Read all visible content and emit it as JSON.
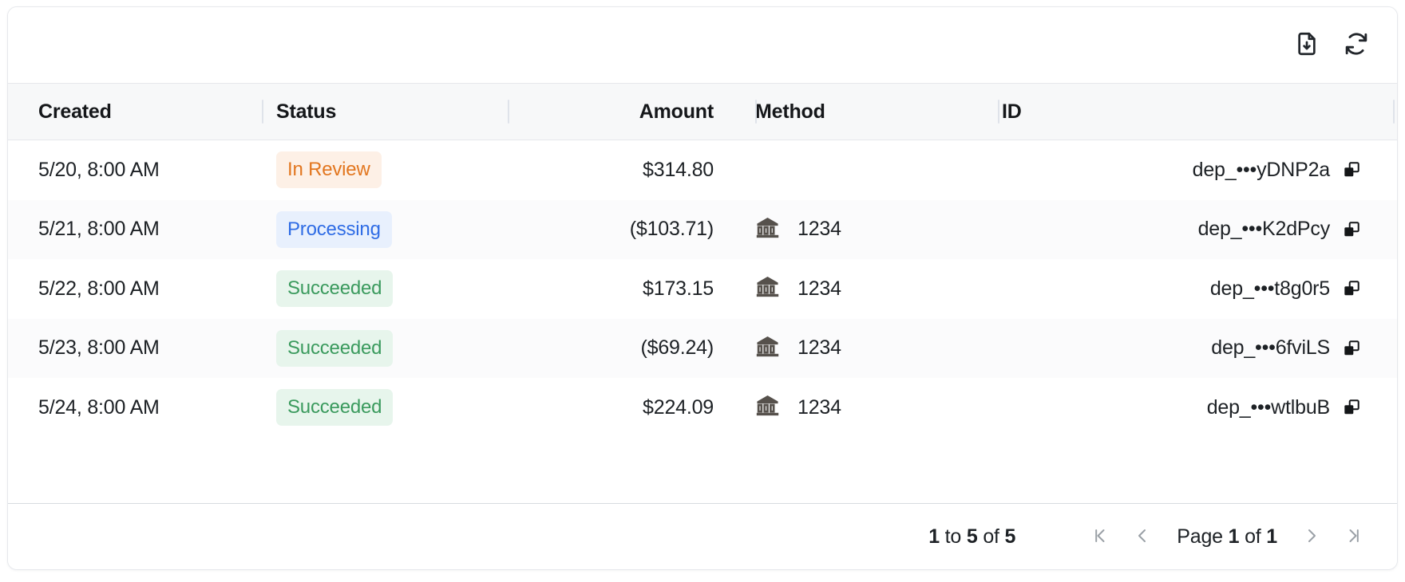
{
  "toolbar": {
    "export_label": "download-document",
    "refresh_label": "refresh"
  },
  "table": {
    "columns": [
      {
        "key": "created",
        "label": "Created",
        "align": "left"
      },
      {
        "key": "status",
        "label": "Status",
        "align": "left"
      },
      {
        "key": "amount",
        "label": "Amount",
        "align": "right"
      },
      {
        "key": "method",
        "label": "Method",
        "align": "left"
      },
      {
        "key": "id",
        "label": "ID",
        "align": "right"
      }
    ],
    "rows": [
      {
        "created": "5/20, 8:00 AM",
        "status": "In Review",
        "status_kind": "review",
        "amount": "$314.80",
        "method_icon": "",
        "method": "",
        "id": "dep_•••yDNP2a"
      },
      {
        "created": "5/21, 8:00 AM",
        "status": "Processing",
        "status_kind": "process",
        "amount": "($103.71)",
        "method_icon": "bank",
        "method": "1234",
        "id": "dep_•••K2dPcy"
      },
      {
        "created": "5/22, 8:00 AM",
        "status": "Succeeded",
        "status_kind": "succeeded",
        "amount": "$173.15",
        "method_icon": "bank",
        "method": "1234",
        "id": "dep_•••t8g0r5"
      },
      {
        "created": "5/23, 8:00 AM",
        "status": "Succeeded",
        "status_kind": "succeeded",
        "amount": "($69.24)",
        "method_icon": "bank",
        "method": "1234",
        "id": "dep_•••6fviLS"
      },
      {
        "created": "5/24, 8:00 AM",
        "status": "Succeeded",
        "status_kind": "succeeded",
        "amount": "$224.09",
        "method_icon": "bank",
        "method": "1234",
        "id": "dep_•••wtlbuB"
      }
    ]
  },
  "pagination": {
    "range_from": "1",
    "range_to": "5",
    "range_total": "5",
    "range_sep_1": " to ",
    "range_sep_2": " of ",
    "page_prefix": "Page ",
    "page_current": "1",
    "page_sep": " of ",
    "page_total": "1",
    "first_label": "first-page",
    "prev_label": "previous-page",
    "next_label": "next-page",
    "last_label": "last-page"
  },
  "colors": {
    "status_review_text": "#e2761f",
    "status_review_bg": "#fdf0e6",
    "status_processing_text": "#2f6ce5",
    "status_processing_bg": "#e8f0fd",
    "status_succeeded_text": "#3a9a5d",
    "status_succeeded_bg": "#e7f5ec",
    "header_bg": "#f7f8f9",
    "row_alt_bg": "#fbfbfc",
    "border": "#e6e8ec",
    "icon": "#56514c",
    "nav_icon": "#9aa0a6"
  }
}
